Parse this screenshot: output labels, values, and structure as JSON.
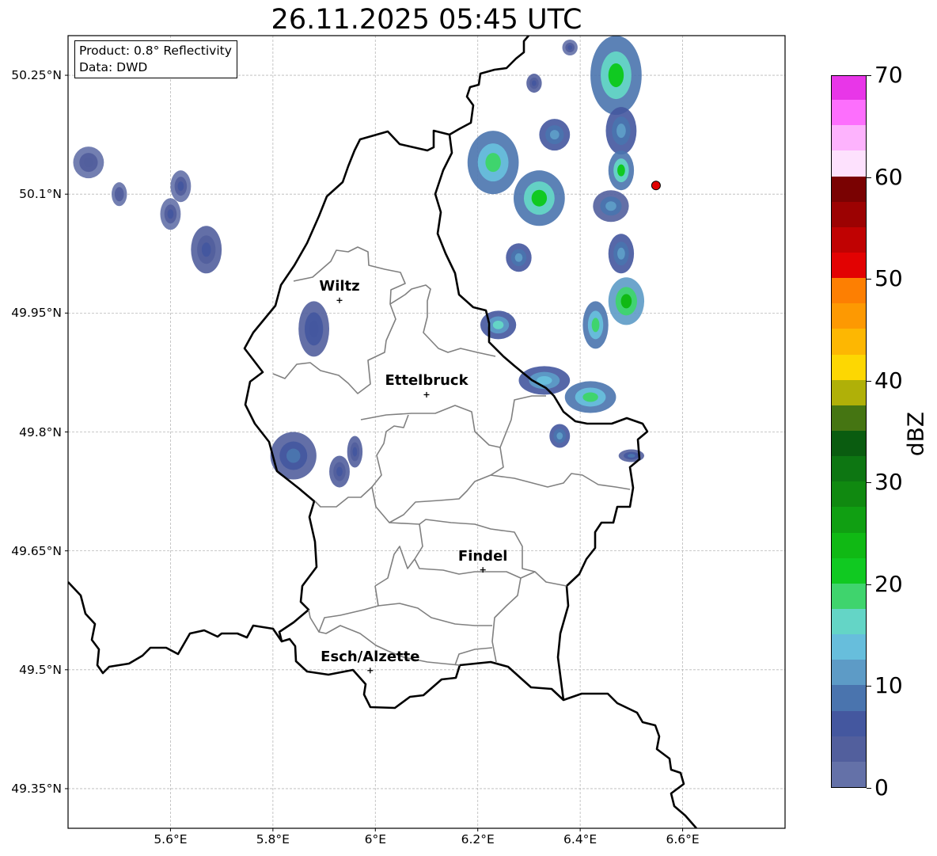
{
  "title": "26.11.2025 05:45 UTC",
  "info_box": {
    "product": "Product: 0.8° Reflectivity",
    "data_source": "Data: DWD"
  },
  "map": {
    "lon_range": [
      5.4,
      6.8
    ],
    "lat_range": [
      49.3,
      50.3
    ],
    "lat_ticks": [
      {
        "value": 50.25,
        "label": "50.25°N"
      },
      {
        "value": 50.1,
        "label": "50.1°N"
      },
      {
        "value": 49.95,
        "label": "49.95°N"
      },
      {
        "value": 49.8,
        "label": "49.8°N"
      },
      {
        "value": 49.65,
        "label": "49.65°N"
      },
      {
        "value": 49.5,
        "label": "49.5°N"
      },
      {
        "value": 49.35,
        "label": "49.35°N"
      }
    ],
    "lon_ticks": [
      {
        "value": 5.6,
        "label": "5.6°E"
      },
      {
        "value": 5.8,
        "label": "5.8°E"
      },
      {
        "value": 6.0,
        "label": "6°E"
      },
      {
        "value": 6.2,
        "label": "6.2°E"
      },
      {
        "value": 6.4,
        "label": "6.4°E"
      },
      {
        "value": 6.6,
        "label": "6.6°E"
      }
    ],
    "grid": true,
    "cities": [
      {
        "name": "Wiltz",
        "lon": 5.93,
        "lat": 49.966
      },
      {
        "name": "Ettelbruck",
        "lon": 6.1,
        "lat": 49.847
      },
      {
        "name": "Findel",
        "lon": 6.21,
        "lat": 49.626
      },
      {
        "name": "Esch/Alzette",
        "lon": 5.99,
        "lat": 49.499
      }
    ],
    "radar_site": {
      "lon": 6.548,
      "lat": 50.111,
      "color": "#e00000"
    },
    "echoes": [
      {
        "lon": 5.44,
        "lat": 50.14,
        "rx": 0.03,
        "ry": 0.02,
        "dbz": 4
      },
      {
        "lon": 5.62,
        "lat": 50.11,
        "rx": 0.02,
        "ry": 0.02,
        "dbz": 5
      },
      {
        "lon": 5.5,
        "lat": 50.1,
        "rx": 0.015,
        "ry": 0.015,
        "dbz": 4
      },
      {
        "lon": 5.67,
        "lat": 50.03,
        "rx": 0.03,
        "ry": 0.03,
        "dbz": 6
      },
      {
        "lon": 5.6,
        "lat": 50.075,
        "rx": 0.02,
        "ry": 0.02,
        "dbz": 5
      },
      {
        "lon": 5.88,
        "lat": 49.93,
        "rx": 0.03,
        "ry": 0.035,
        "dbz": 7
      },
      {
        "lon": 5.84,
        "lat": 49.77,
        "rx": 0.045,
        "ry": 0.03,
        "dbz": 8
      },
      {
        "lon": 5.93,
        "lat": 49.75,
        "rx": 0.02,
        "ry": 0.02,
        "dbz": 6
      },
      {
        "lon": 5.96,
        "lat": 49.775,
        "rx": 0.015,
        "ry": 0.02,
        "dbz": 6
      },
      {
        "lon": 6.24,
        "lat": 49.935,
        "rx": 0.035,
        "ry": 0.018,
        "dbz": 16
      },
      {
        "lon": 6.33,
        "lat": 49.865,
        "rx": 0.05,
        "ry": 0.018,
        "dbz": 14
      },
      {
        "lon": 6.42,
        "lat": 49.844,
        "rx": 0.05,
        "ry": 0.02,
        "dbz": 18
      },
      {
        "lon": 6.36,
        "lat": 49.795,
        "rx": 0.02,
        "ry": 0.015,
        "dbz": 12
      },
      {
        "lon": 6.23,
        "lat": 50.14,
        "rx": 0.05,
        "ry": 0.04,
        "dbz": 19
      },
      {
        "lon": 6.32,
        "lat": 50.095,
        "rx": 0.05,
        "ry": 0.035,
        "dbz": 21
      },
      {
        "lon": 6.28,
        "lat": 50.02,
        "rx": 0.025,
        "ry": 0.018,
        "dbz": 12
      },
      {
        "lon": 6.35,
        "lat": 50.175,
        "rx": 0.03,
        "ry": 0.02,
        "dbz": 12
      },
      {
        "lon": 6.47,
        "lat": 50.25,
        "rx": 0.05,
        "ry": 0.05,
        "dbz": 22
      },
      {
        "lon": 6.48,
        "lat": 50.18,
        "rx": 0.03,
        "ry": 0.03,
        "dbz": 12
      },
      {
        "lon": 6.48,
        "lat": 50.13,
        "rx": 0.025,
        "ry": 0.025,
        "dbz": 20
      },
      {
        "lon": 6.46,
        "lat": 50.085,
        "rx": 0.035,
        "ry": 0.02,
        "dbz": 10
      },
      {
        "lon": 6.48,
        "lat": 50.025,
        "rx": 0.025,
        "ry": 0.025,
        "dbz": 12
      },
      {
        "lon": 6.49,
        "lat": 49.965,
        "rx": 0.035,
        "ry": 0.03,
        "dbz": 24
      },
      {
        "lon": 6.43,
        "lat": 49.935,
        "rx": 0.025,
        "ry": 0.03,
        "dbz": 18
      },
      {
        "lon": 6.5,
        "lat": 49.77,
        "rx": 0.025,
        "ry": 0.008,
        "dbz": 8
      },
      {
        "lon": 6.31,
        "lat": 50.24,
        "rx": 0.015,
        "ry": 0.012,
        "dbz": 6
      },
      {
        "lon": 6.38,
        "lat": 50.285,
        "rx": 0.015,
        "ry": 0.01,
        "dbz": 5
      }
    ]
  },
  "colorbar": {
    "label": "dBZ",
    "min": 0,
    "max": 70,
    "ticks": [
      0,
      10,
      20,
      30,
      40,
      50,
      60,
      70
    ],
    "colors": [
      "#6471a8",
      "#525f9d",
      "#44579f",
      "#4a74ae",
      "#5d9bc6",
      "#67bedc",
      "#64d5c6",
      "#3fd46d",
      "#10c921",
      "#10b914",
      "#109f12",
      "#108910",
      "#0d7612",
      "#0a5c10",
      "#457512",
      "#b0b008",
      "#fdd702",
      "#fdb702",
      "#fd9902",
      "#fd7f02",
      "#e20202",
      "#c00202",
      "#9c0202",
      "#7a0202",
      "#fde1fd",
      "#fdb3fd",
      "#fd6ffd",
      "#e836e8"
    ]
  }
}
